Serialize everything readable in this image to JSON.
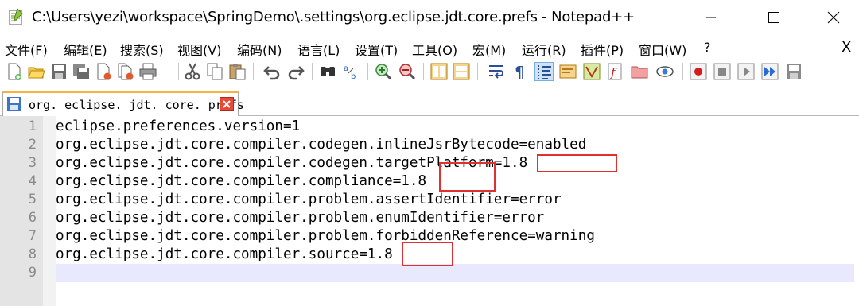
{
  "window": {
    "title": "C:\\Users\\yezi\\workspace\\SpringDemo\\.settings\\org.eclipse.jdt.core.prefs - Notepad++",
    "app_icon": "notepad-plus-plus-icon",
    "controls": {
      "minimize": "minimize-icon",
      "maximize": "maximize-icon",
      "close": "close-icon"
    }
  },
  "menu": {
    "items": [
      "文件(F)",
      "编辑(E)",
      "搜索(S)",
      "视图(V)",
      "编码(N)",
      "语言(L)",
      "设置(T)",
      "工具(O)",
      "宏(M)",
      "运行(R)",
      "插件(P)",
      "窗口(W)",
      "?"
    ],
    "close_label": "X"
  },
  "toolbar": {
    "buttons": [
      "new-file-icon",
      "open-file-icon",
      "save-icon",
      "save-all-icon",
      "close-icon",
      "close-all-icon",
      "print-icon",
      "cut-icon",
      "copy-icon",
      "paste-icon",
      "undo-icon",
      "redo-icon",
      "find-icon",
      "replace-icon",
      "zoom-in-icon",
      "zoom-out-icon",
      "sync-vertical-icon",
      "sync-horizontal-icon",
      "word-wrap-icon",
      "show-all-characters-icon",
      "indent-guide-icon",
      "user-defined-language-icon",
      "document-map-icon",
      "function-list-icon",
      "folder-workspace-icon",
      "monitoring-icon",
      "record-macro-icon",
      "stop-recording-icon",
      "play-macro-icon",
      "run-macro-multiple-icon",
      "save-macro-icon"
    ],
    "active_button": "indent-guide-icon"
  },
  "tabs": [
    {
      "label": "org. eclipse. jdt. core. prefs",
      "status_icon": "saved-file-icon",
      "close_icon": "tab-close-icon",
      "active": true
    }
  ],
  "editor": {
    "current_line": 9,
    "lines": [
      {
        "num": "1",
        "text": "eclipse.preferences.version=1"
      },
      {
        "num": "2",
        "text": "org.eclipse.jdt.core.compiler.codegen.inlineJsrBytecode=enabled"
      },
      {
        "num": "3",
        "text": "org.eclipse.jdt.core.compiler.codegen.targetPlatform=1.8"
      },
      {
        "num": "4",
        "text": "org.eclipse.jdt.core.compiler.compliance=1.8"
      },
      {
        "num": "5",
        "text": "org.eclipse.jdt.core.compiler.problem.assertIdentifier=error"
      },
      {
        "num": "6",
        "text": "org.eclipse.jdt.core.compiler.problem.enumIdentifier=error"
      },
      {
        "num": "7",
        "text": "org.eclipse.jdt.core.compiler.problem.forbiddenReference=warning"
      },
      {
        "num": "8",
        "text": "org.eclipse.jdt.core.compiler.source=1.8"
      },
      {
        "num": "9",
        "text": ""
      }
    ],
    "annotation_color": "#e03030"
  }
}
